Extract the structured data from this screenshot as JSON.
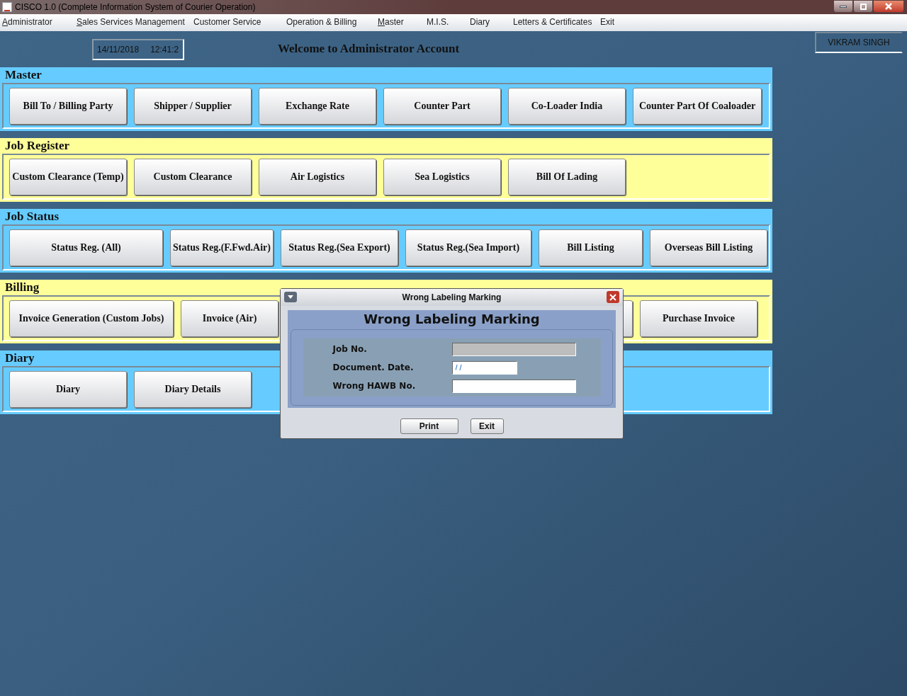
{
  "window": {
    "title": "CISCO 1.0 (Complete Information System of Courier Operation)"
  },
  "menu": [
    {
      "label": "Administrator",
      "mnemonic": true
    },
    {
      "label": "Sales Services Management",
      "mnemonic": true
    },
    {
      "label": "Customer Service"
    },
    {
      "label": "Operation & Billing"
    },
    {
      "label": "Master",
      "mnemonic": true
    },
    {
      "label": "M.I.S."
    },
    {
      "label": "Diary"
    },
    {
      "label": "Letters & Certificates"
    },
    {
      "label": "Exit"
    }
  ],
  "clock": {
    "date": "14/11/2018",
    "time": "12:41:2"
  },
  "welcome": "Welcome to Administrator Account",
  "user": "VIKRAM SINGH",
  "sections": [
    {
      "title": "Master",
      "color": "#66ccff",
      "buttons": [
        {
          "label": "Bill To / Billing Party"
        },
        {
          "label": "Shipper / Supplier"
        },
        {
          "label": "Exchange Rate"
        },
        {
          "label": "Counter Part"
        },
        {
          "label": "Co-Loader India"
        },
        {
          "label": "Counter Part Of Coaloader"
        }
      ]
    },
    {
      "title": "Job Register",
      "color": "#ffff99",
      "buttons": [
        {
          "label": "Custom Clearance (Temp)"
        },
        {
          "label": "Custom Clearance"
        },
        {
          "label": "Air Logistics"
        },
        {
          "label": "Sea Logistics"
        },
        {
          "label": "Bill Of Lading"
        }
      ]
    },
    {
      "title": "Job Status",
      "color": "#66ccff",
      "buttons": [
        {
          "label": "Status Reg. (All)"
        },
        {
          "label": "Status Reg.(F.Fwd.Air)"
        },
        {
          "label": "Status Reg.(Sea Export)"
        },
        {
          "label": "Status Reg.(Sea Import)"
        },
        {
          "label": "Bill Listing"
        },
        {
          "label": "Overseas Bill Listing"
        }
      ]
    },
    {
      "title": "Billing",
      "color": "#ffff99",
      "buttons": [
        {
          "label": "Invoice Generation (Custom Jobs)"
        },
        {
          "label": "Invoice (Air)"
        },
        {
          "label": "Purchase Invoice"
        }
      ]
    },
    {
      "title": "Diary",
      "color": "#66ccff",
      "buttons": [
        {
          "label": "Diary"
        },
        {
          "label": "Diary Details"
        }
      ]
    }
  ],
  "dialog": {
    "title": "Wrong Labeling Marking",
    "heading": "Wrong Labeling Marking",
    "fields": [
      {
        "label": "Job No.",
        "disabled": true
      },
      {
        "label": "Document. Date.",
        "value": "/ /",
        "disabled": false,
        "kind": "short"
      },
      {
        "label": "Wrong HAWB No.",
        "disabled": false
      }
    ],
    "buttons": [
      "Print",
      "Exit"
    ]
  }
}
